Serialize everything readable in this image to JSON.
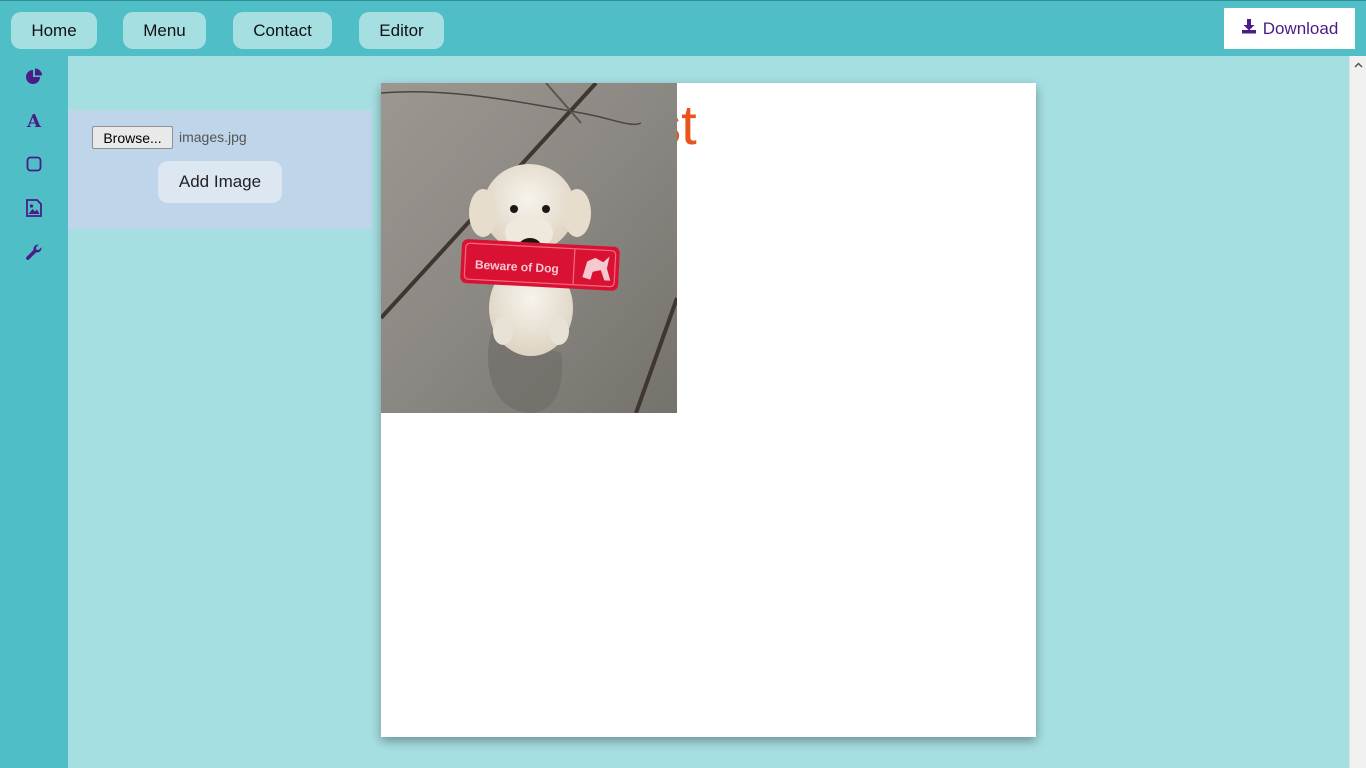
{
  "nav": {
    "home": "Home",
    "menu": "Menu",
    "contact": "Contact",
    "editor": "Editor",
    "download": "Download"
  },
  "sidebar": {
    "items": [
      {
        "icon": "pie-chart-icon"
      },
      {
        "icon": "text-icon",
        "glyph": "A"
      },
      {
        "icon": "square-icon"
      },
      {
        "icon": "image-icon"
      },
      {
        "icon": "wrench-icon"
      }
    ]
  },
  "upload": {
    "browse_label": "Browse...",
    "file_name": "images.jpg",
    "add_image_label": "Add Image"
  },
  "canvas": {
    "text": "Test",
    "text_color": "#e8531e",
    "image_sign_text": "Beware of Dog"
  },
  "colors": {
    "topbar": "#4fbec7",
    "background": "#a6dfe2",
    "accent": "#4b1c86",
    "panel": "#bfd5ea"
  }
}
